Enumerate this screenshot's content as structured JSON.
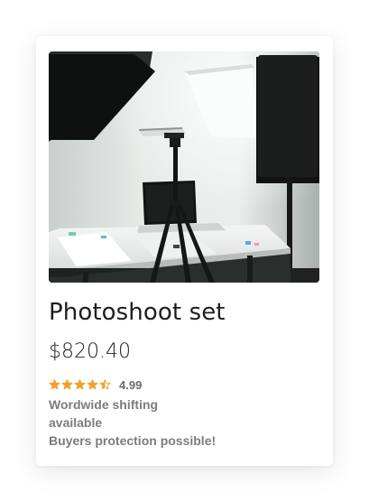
{
  "product": {
    "title": "Photoshoot set",
    "price": "$820.40",
    "rating": {
      "value": "4.99",
      "stars": 4.5,
      "max_stars": 5,
      "star_color": "#f2a12b"
    },
    "shipping_text": "Wordwide shifting",
    "shipping_text_2": "available",
    "protection_text": "Buyers protection possible!"
  }
}
